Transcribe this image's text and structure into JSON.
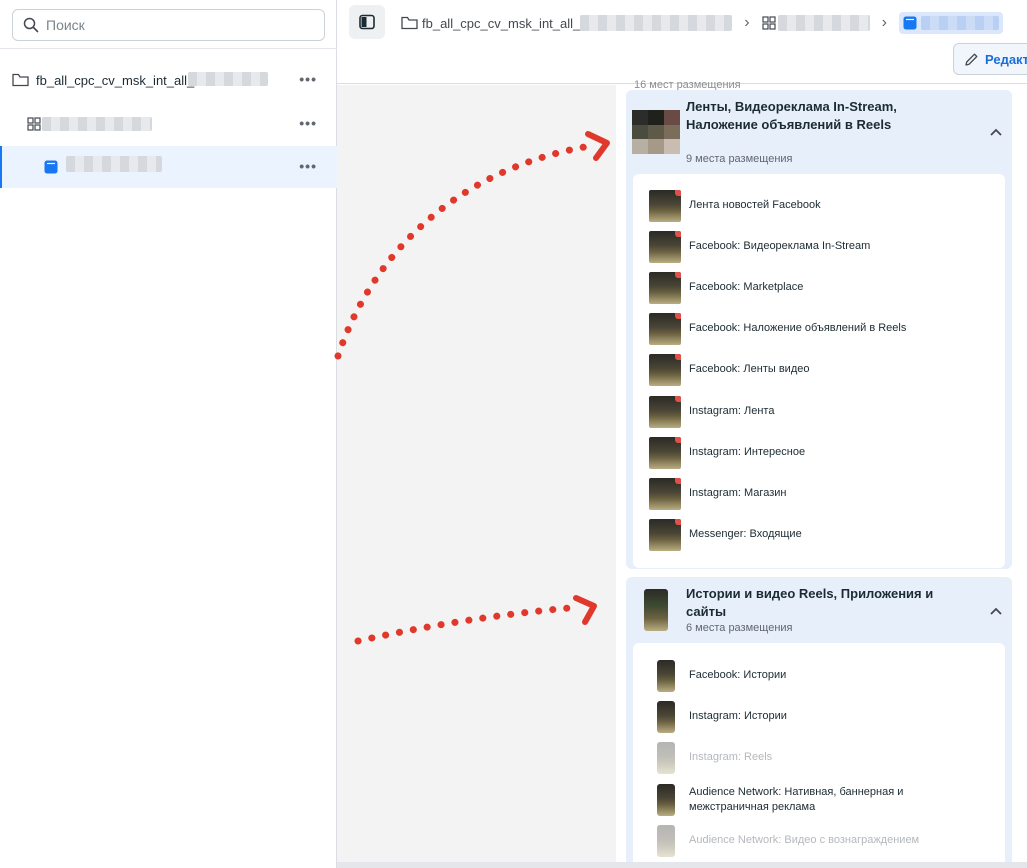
{
  "sidebar": {
    "search": {
      "placeholder": "Поиск",
      "icon": "search-icon"
    },
    "tree": [
      {
        "label": "fb_all_cpc_cv_msk_int_all_",
        "icon": "folder-icon",
        "more": "•••"
      },
      {
        "label": "",
        "icon": "ad-set-grid-icon",
        "more": "•••"
      },
      {
        "label": "",
        "icon": "ad-icon",
        "more": "•••"
      }
    ]
  },
  "topbar": {
    "breadcrumb": {
      "campaign": "fb_all_cpc_cv_msk_int_all_",
      "separator": "›"
    },
    "edit_label": "Редакт"
  },
  "placements": {
    "truncated_header": "16 мест размещения",
    "groups": [
      {
        "title": "Ленты, Видеореклама In-Stream, Наложение объявлений в Reels",
        "count_label": "9 места размещения",
        "items": [
          {
            "label": "Лента новостей Facebook",
            "enabled": true
          },
          {
            "label": "Facebook: Видеореклама In-Stream",
            "enabled": true
          },
          {
            "label": "Facebook: Marketplace",
            "enabled": true
          },
          {
            "label": "Facebook: Наложение объявлений в Reels",
            "enabled": true
          },
          {
            "label": "Facebook: Ленты видео",
            "enabled": true
          },
          {
            "label": "Instagram: Лента",
            "enabled": true
          },
          {
            "label": "Instagram: Интересное",
            "enabled": true
          },
          {
            "label": "Instagram: Магазин",
            "enabled": true
          },
          {
            "label": "Messenger: Входящие",
            "enabled": true
          }
        ]
      },
      {
        "title": "Истории и видео Reels, Приложения и сайты",
        "count_label": "6 места размещения",
        "items": [
          {
            "label": "Facebook: Истории",
            "enabled": true
          },
          {
            "label": "Instagram: Истории",
            "enabled": true
          },
          {
            "label": "Instagram: Reels",
            "enabled": false
          },
          {
            "label": "Audience Network: Нативная, баннерная и межстраничная реклама",
            "enabled": true
          },
          {
            "label": "Audience Network: Видео с вознаграждением",
            "enabled": false
          }
        ]
      }
    ]
  },
  "colors": {
    "accent": "#1877f2",
    "group_bg": "#e7effb",
    "annotation_arrow": "#e0392b"
  }
}
